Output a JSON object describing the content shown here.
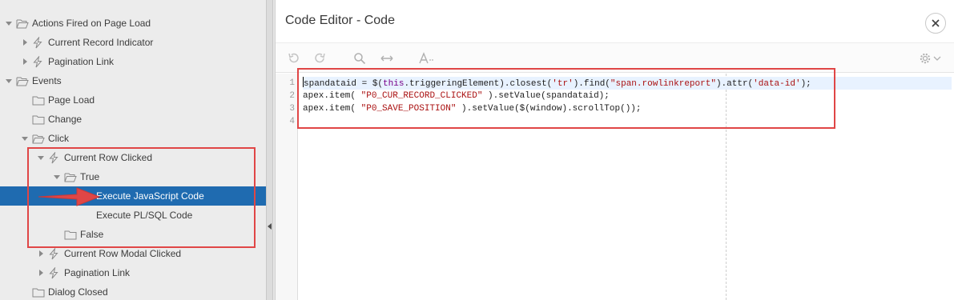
{
  "tree": {
    "items": [
      {
        "label": "Actions Fired on Page Load",
        "icon": "folder-open-icon",
        "toggle": "expanded"
      },
      {
        "label": "Current Record Indicator",
        "icon": "lightning-icon",
        "toggle": "collapsed"
      },
      {
        "label": "Pagination Link",
        "icon": "lightning-icon",
        "toggle": "collapsed"
      },
      {
        "label": "Events",
        "icon": "folder-open-icon",
        "toggle": "expanded"
      },
      {
        "label": "Page Load",
        "icon": "folder-icon",
        "toggle": "none"
      },
      {
        "label": "Change",
        "icon": "folder-icon",
        "toggle": "none"
      },
      {
        "label": "Click",
        "icon": "folder-open-icon",
        "toggle": "expanded"
      },
      {
        "label": "Current Row Clicked",
        "icon": "lightning-icon",
        "toggle": "expanded"
      },
      {
        "label": "True",
        "icon": "folder-open-icon",
        "toggle": "expanded"
      },
      {
        "label": "Execute JavaScript Code",
        "icon": "none",
        "toggle": "none",
        "selected": true
      },
      {
        "label": "Execute PL/SQL Code",
        "icon": "none",
        "toggle": "none"
      },
      {
        "label": "False",
        "icon": "folder-icon",
        "toggle": "none"
      },
      {
        "label": "Current Row Modal Clicked",
        "icon": "lightning-icon",
        "toggle": "collapsed"
      },
      {
        "label": "Pagination Link",
        "icon": "lightning-icon",
        "toggle": "collapsed"
      },
      {
        "label": "Dialog Closed",
        "icon": "folder-icon",
        "toggle": "none"
      }
    ]
  },
  "dialog": {
    "title": "Code Editor - Code",
    "toolbar_icons": [
      "undo-icon",
      "redo-icon",
      "search-icon",
      "replace-icon",
      "autocomplete-icon",
      "settings-gear-icon"
    ]
  },
  "editor": {
    "line_numbers": [
      "1",
      "2",
      "3",
      "4"
    ],
    "lines": [
      [
        {
          "t": "spandataid = $(",
          "c": ""
        },
        {
          "t": "this",
          "c": "kw"
        },
        {
          "t": ".triggeringElement).closest(",
          "c": ""
        },
        {
          "t": "'tr'",
          "c": "str"
        },
        {
          "t": ").find(",
          "c": ""
        },
        {
          "t": "\"span.rowlinkreport\"",
          "c": "str"
        },
        {
          "t": ").attr(",
          "c": ""
        },
        {
          "t": "'data-id'",
          "c": "str"
        },
        {
          "t": ");",
          "c": ""
        }
      ],
      [
        {
          "t": "apex.item( ",
          "c": ""
        },
        {
          "t": "\"P0_CUR_RECORD_CLICKED\"",
          "c": "str"
        },
        {
          "t": " ).setValue(spandataid);",
          "c": ""
        }
      ],
      [
        {
          "t": "apex.item( ",
          "c": ""
        },
        {
          "t": "\"P0_SAVE_POSITION\"",
          "c": "str"
        },
        {
          "t": " ).setValue($(window).scrollTop());",
          "c": ""
        }
      ],
      []
    ]
  },
  "colors": {
    "selection": "#1f6bb0",
    "annotation": "#e04646",
    "keyword": "#770088",
    "string": "#aa1111"
  }
}
